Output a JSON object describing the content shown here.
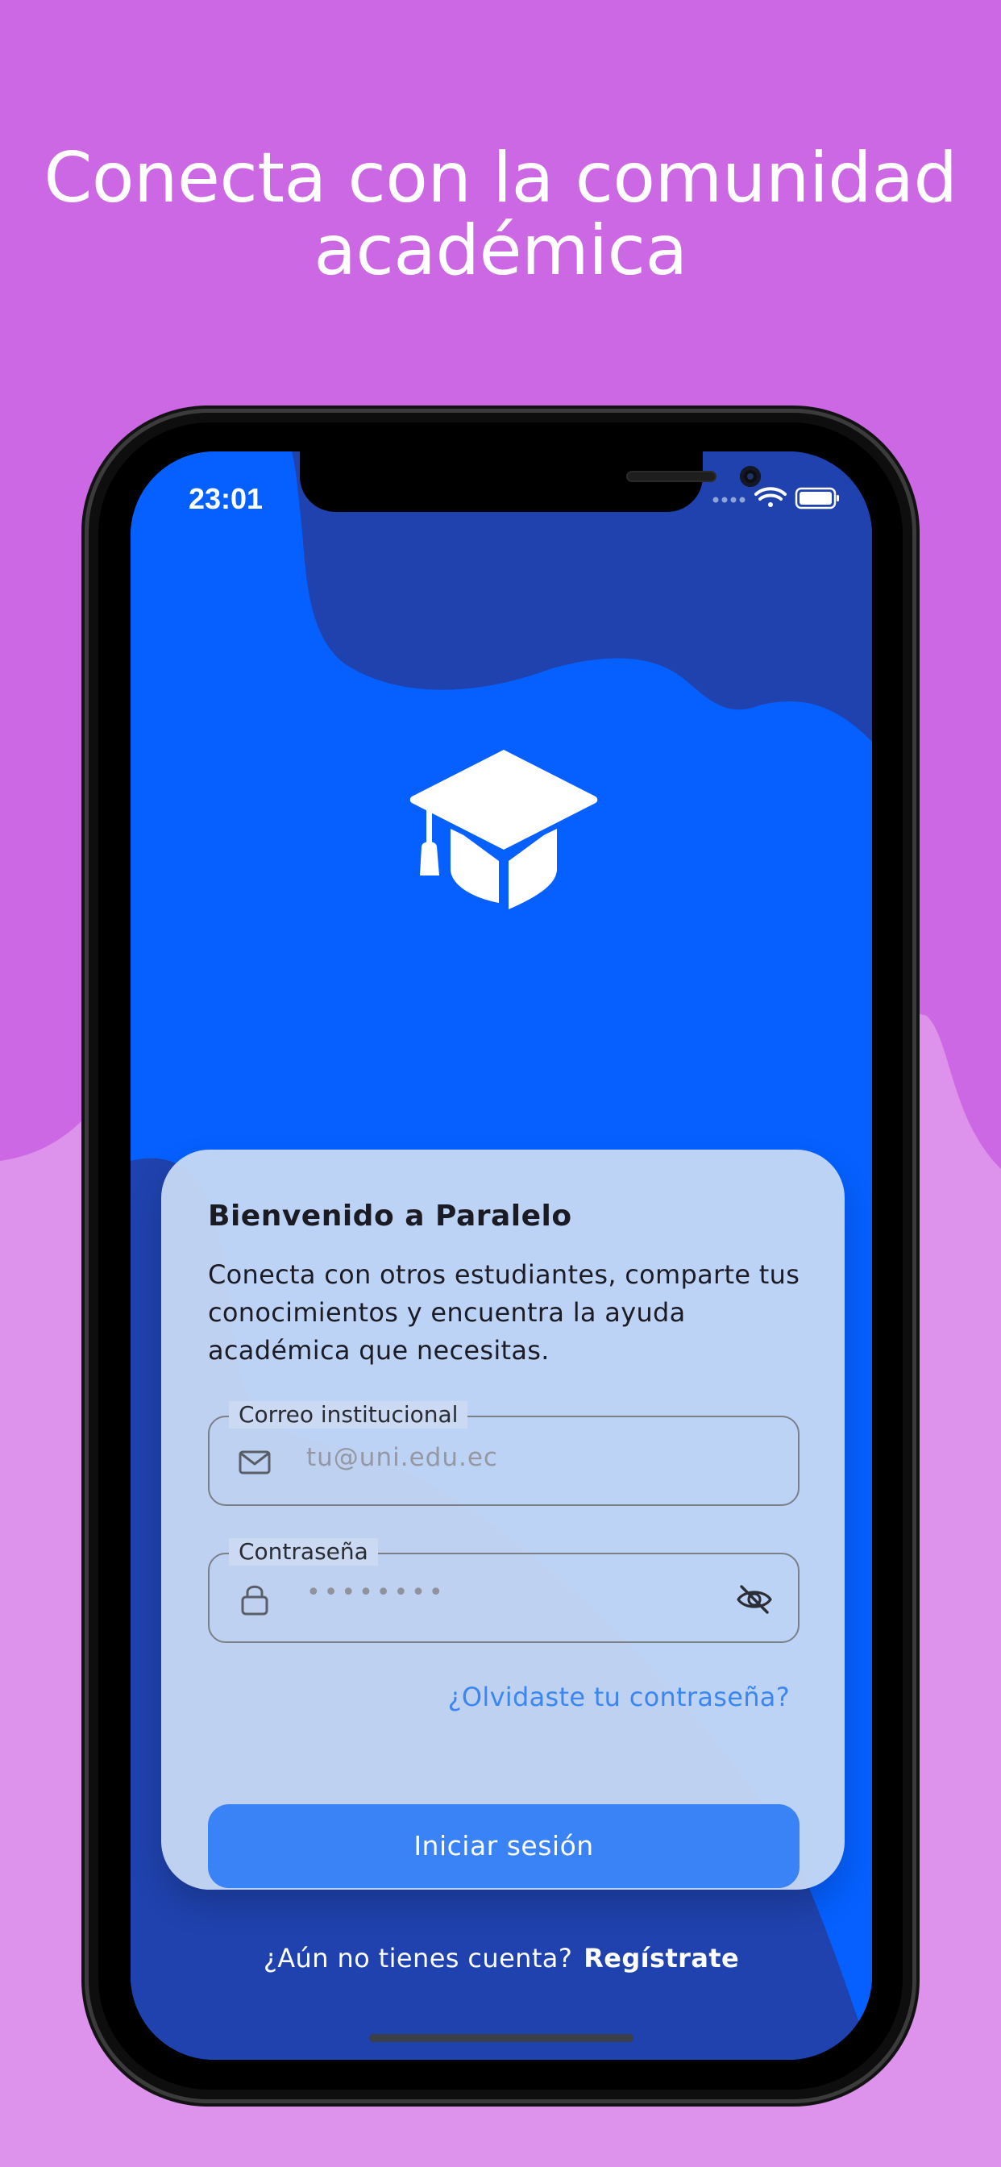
{
  "headline": {
    "line1": "Conecta con la comunidad",
    "line2": "académica"
  },
  "status_bar": {
    "time": "23:01",
    "signal_icon": "cellular-dots-icon",
    "wifi_icon": "wifi-icon",
    "battery_icon": "battery-icon"
  },
  "logo_icon": "graduation-cap-icon",
  "card": {
    "title": "Bienvenido a Paralelo",
    "description": "Conecta con otros estudiantes, comparte tus conocimientos y encuentra la ayuda académica que necesitas.",
    "email": {
      "label": "Correo institucional",
      "placeholder": "tu@uni.edu.ec",
      "icon": "mail-icon"
    },
    "password": {
      "label": "Contraseña",
      "value": "••••••••",
      "icon": "lock-icon",
      "toggle_icon": "eye-off-icon"
    },
    "forgot_link": "¿Olvidaste tu contraseña?",
    "login_button": "Iniciar sesión"
  },
  "signup": {
    "prompt": "¿Aún no tienes cuenta?",
    "link": "Regístrate"
  },
  "colors": {
    "page_background": "#cc68e3",
    "page_background_light": "#dd93ec",
    "screen_blue": "#0560ff",
    "screen_dark_blue": "#1f42ae",
    "button_blue": "#3a83f6",
    "link_blue": "#3a86f2"
  }
}
